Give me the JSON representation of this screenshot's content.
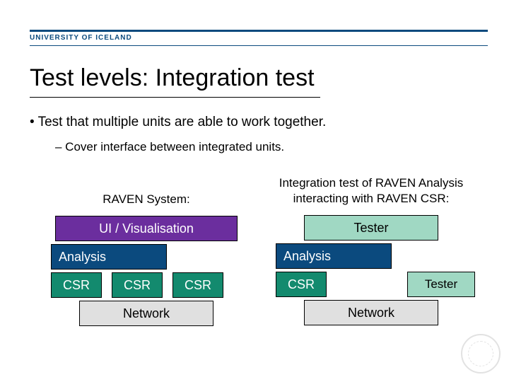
{
  "header": {
    "university": "UNIVERSITY OF ICELAND"
  },
  "title": "Test levels: Integration test",
  "bullets": {
    "main": "•  Test that multiple units are able to work together.",
    "sub": "–  Cover interface between integrated units."
  },
  "diagram": {
    "left": {
      "heading": "RAVEN System:",
      "ui": "UI / Visualisation",
      "ana": "Analysis",
      "csr": "CSR",
      "net": "Network"
    },
    "right": {
      "heading": "Integration test of RAVEN Analysis interacting with RAVEN CSR:",
      "tester": "Tester",
      "ana": "Analysis",
      "csr": "CSR",
      "net": "Network"
    }
  }
}
